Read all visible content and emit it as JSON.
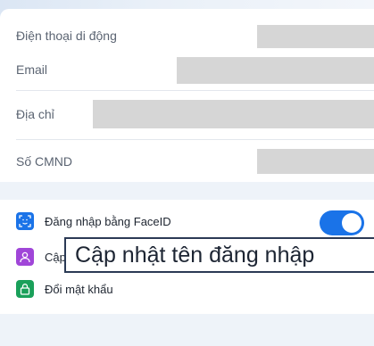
{
  "fields": [
    {
      "label": "Điện thoại di động"
    },
    {
      "label": "Email"
    },
    {
      "label": "Địa chỉ"
    },
    {
      "label": "Số CMND"
    }
  ],
  "menu": [
    {
      "label": "Đăng nhập bằng FaceID",
      "icon": "faceid-icon",
      "color": "#1a73e8"
    },
    {
      "label": "Cập nhật tên đăng nhập",
      "icon": "user-icon",
      "color": "#a046d8"
    },
    {
      "label": "Đổi mật khẩu",
      "icon": "lock-icon",
      "color": "#1aa05a"
    }
  ],
  "toggle": {
    "state": "on",
    "color": "#1a73e8"
  },
  "overlay_text": "Cập nhật tên đăng nhập"
}
